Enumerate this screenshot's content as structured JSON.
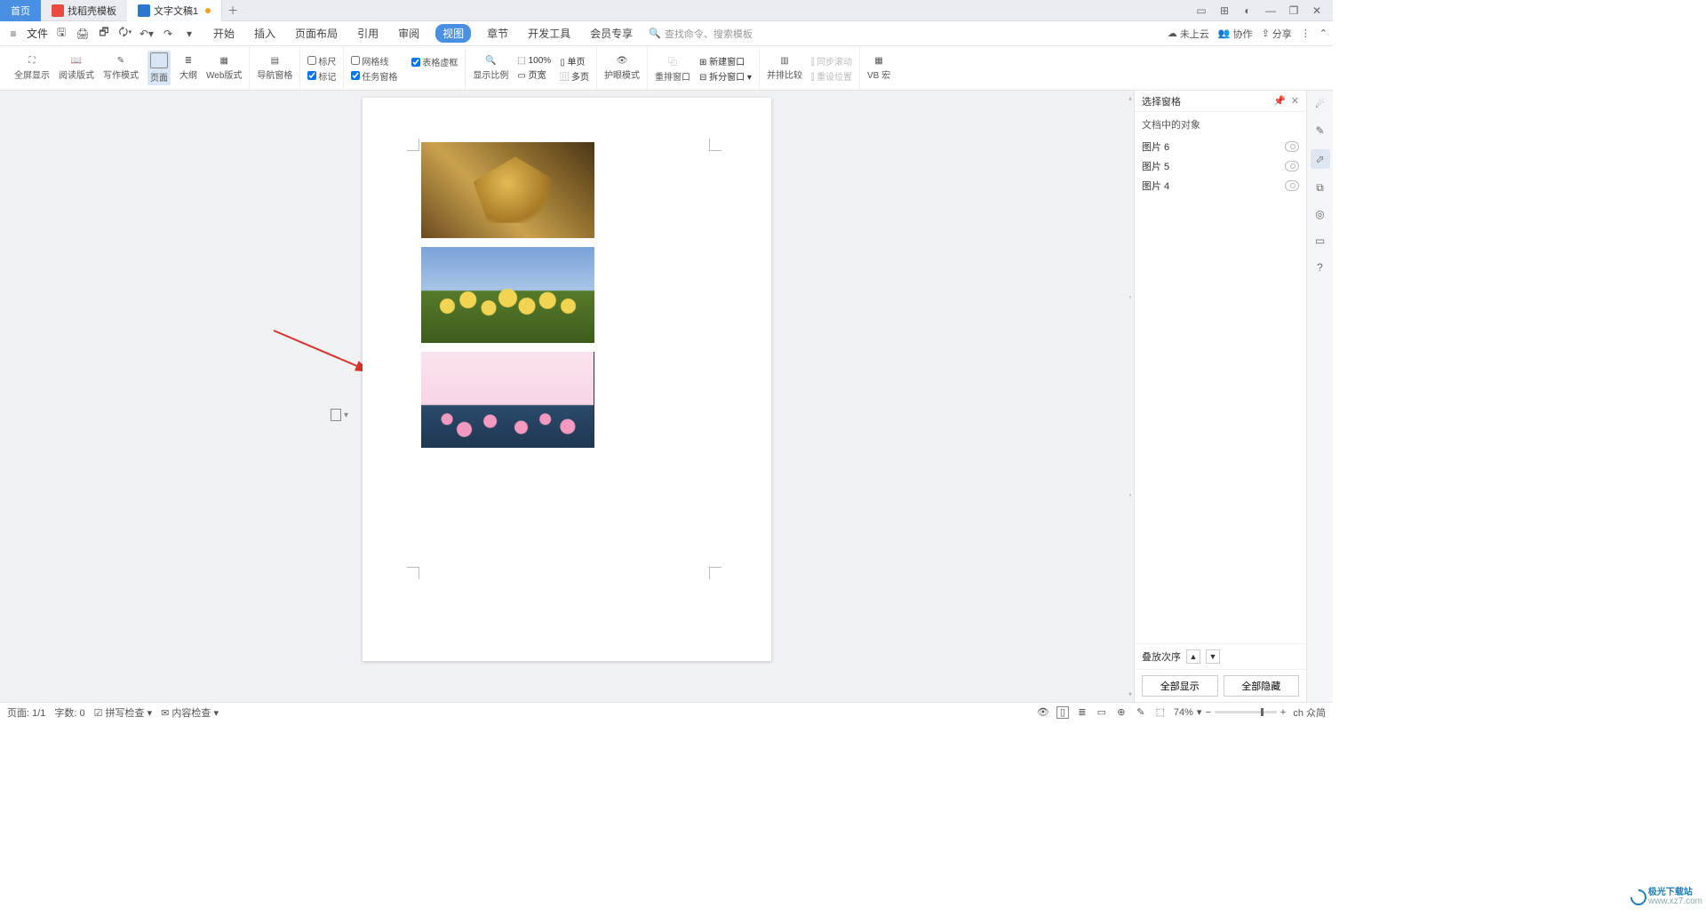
{
  "titlebar": {
    "home": "首页",
    "template_tab": "找稻壳模板",
    "doc_tab": "文字文稿1"
  },
  "menu": {
    "file": "文件",
    "tabs": [
      "开始",
      "插入",
      "页面布局",
      "引用",
      "审阅",
      "视图",
      "章节",
      "开发工具",
      "会员专享"
    ],
    "active_index": 5,
    "search_placeholder": "查找命令、搜索模板",
    "cloud": "未上云",
    "coop": "协作",
    "share": "分享"
  },
  "ribbon": {
    "fullscreen": "全屏显示",
    "read": "阅读版式",
    "write": "写作模式",
    "page": "页面",
    "outline": "大纲",
    "web": "Web版式",
    "navpane": "导航窗格",
    "ruler": "标尺",
    "grid": "网格线",
    "tableframe": "表格虚框",
    "mark": "标记",
    "taskpane": "任务窗格",
    "showscale": "显示比例",
    "zoom100": "100%",
    "pagewidth": "页宽",
    "single": "单页",
    "multi": "多页",
    "eyecare": "护眼模式",
    "rearrange": "重排窗口",
    "newwin": "新建窗口",
    "splitwin": "拆分窗口",
    "compare": "并排比较",
    "syncscroll": "同步滚动",
    "resetpos": "重设位置",
    "vbmacro": "VB 宏"
  },
  "panel": {
    "title": "选择窗格",
    "subtitle": "文档中的对象",
    "objects": [
      "图片 6",
      "图片 5",
      "图片 4"
    ],
    "stack": "叠放次序",
    "showall": "全部显示",
    "hideall": "全部隐藏"
  },
  "status": {
    "page": "页面: 1/1",
    "words": "字数: 0",
    "spell": "拼写检查",
    "content": "内容检查",
    "zoom": "74%",
    "ime": "ch 众简"
  },
  "watermark": {
    "brand": "极光下载站",
    "url": "www.xz7.com"
  }
}
